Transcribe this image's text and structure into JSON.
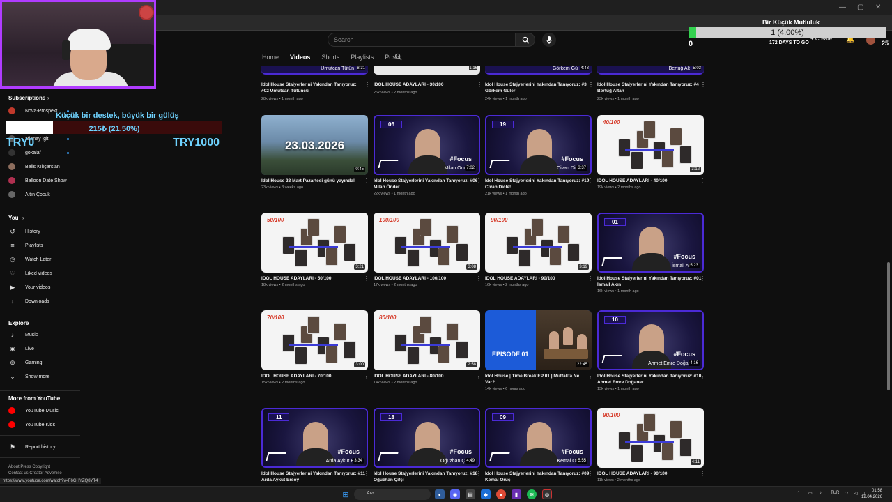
{
  "overlay": {
    "goal": {
      "title": "Bir Küçük Mutluluk",
      "progress_text": "1 (4.00%)",
      "progress_fraction": 0.04,
      "min": "0",
      "days_left": "172 DAYS TO GO",
      "max": "25"
    },
    "donation": {
      "title": "Küçük bir destek, büyük bir gülüş",
      "amount_text": "215₺ (21.50%)",
      "progress_fraction": 0.215,
      "min": "TRY0",
      "max": "TRY1000"
    }
  },
  "header": {
    "search_placeholder": "Search",
    "create_label": "Create"
  },
  "channel_tabs": [
    "Home",
    "Videos",
    "Shorts",
    "Playlists",
    "Posts"
  ],
  "sidebar": {
    "subscriptions_label": "Subscriptions",
    "subscriptions": [
      {
        "label": "Nova-Prospekt",
        "color": "#c0392b"
      },
      {
        "label": "Onur",
        "color": "#7f8c8d"
      },
      {
        "label": "aflanay igit",
        "color": "#555"
      },
      {
        "label": "gokalaf",
        "color": "#333"
      },
      {
        "label": "Belis Kılıçarslan",
        "color": "#8e6e5e"
      },
      {
        "label": "Balloon Date Show",
        "color": "#b03050"
      },
      {
        "label": "Altın Çocuk",
        "color": "#666"
      }
    ],
    "you_label": "You",
    "you_items": [
      {
        "label": "History",
        "icon": "history-icon",
        "glyph": "↺"
      },
      {
        "label": "Playlists",
        "icon": "playlists-icon",
        "glyph": "≡"
      },
      {
        "label": "Watch Later",
        "icon": "watch-later-icon",
        "glyph": "◷"
      },
      {
        "label": "Liked videos",
        "icon": "like-icon",
        "glyph": "♡"
      },
      {
        "label": "Your videos",
        "icon": "your-videos-icon",
        "glyph": "▶"
      },
      {
        "label": "Downloads",
        "icon": "download-icon",
        "glyph": "↓"
      }
    ],
    "explore_label": "Explore",
    "explore_items": [
      {
        "label": "Music",
        "icon": "music-icon",
        "glyph": "♪"
      },
      {
        "label": "Live",
        "icon": "live-icon",
        "glyph": "◉"
      },
      {
        "label": "Gaming",
        "icon": "gaming-icon",
        "glyph": "⊕"
      },
      {
        "label": "Show more",
        "icon": "chevron-down-icon",
        "glyph": "⌄"
      }
    ],
    "more_label": "More from YouTube",
    "more_items": [
      {
        "label": "YouTube Music",
        "color": "#ff0000"
      },
      {
        "label": "YouTube Kids",
        "color": "#ff0000"
      }
    ],
    "report_label": "Report history",
    "footer1": "About  Press  Copyright",
    "footer2": "Contact us  Creator  Advertise"
  },
  "top_row": [
    {
      "name": "Umutcan Tütün",
      "dur": "8:31",
      "title": "Idol House Stajyerlerini Yakından Tanıyoruz: #02 Umutcan Tütüncü",
      "meta": "28k views • 1 month ago"
    },
    {
      "name": "",
      "dur": "1:16",
      "title": "IDOL HOUSE ADAYLARI - 30/100",
      "meta": "26k views • 2 months ago"
    },
    {
      "name": "Görkem Gü",
      "dur": "4:43",
      "title": "Idol House Stajyerlerini Yakından Tanıyoruz: #3 Görkem Güler",
      "meta": "24k views • 1 month ago"
    },
    {
      "name": "Bertuğ Alt",
      "dur": "5:03",
      "title": "Idol House Stajyerlerini Yakından Tanıyoruz: #4 Bertuğ Altan",
      "meta": "23k views • 1 month ago"
    }
  ],
  "videos": [
    {
      "kind": "photo",
      "bg": "#5a7a9a",
      "big": "23.03.2026",
      "label": "",
      "name": "",
      "dur": "0:45",
      "title": "Idol House 23 Mart Pazartesi günü yayında!",
      "meta": "23k views • 3 weeks ago"
    },
    {
      "kind": "focus",
      "bg": "#1f1a4a",
      "label": "06",
      "name": "Milan Önc",
      "dur": "7:02",
      "title": "Idol House Stajyerlerini Yakından Tanıyoruz: #06 Milan Önder",
      "meta": "22k views • 1 month ago"
    },
    {
      "kind": "focus",
      "bg": "#1f1a4a",
      "label": "19",
      "name": "Civan Dic",
      "dur": "3:37",
      "title": "Idol House Stajyerlerini Yakından Tanıyoruz: #19 Civan Dicle!",
      "meta": "21k views • 1 month ago"
    },
    {
      "kind": "collage",
      "bg": "#f4f4f4",
      "label": "40/100",
      "name": "",
      "dur": "3:12",
      "title": "IDOL HOUSE ADAYLARI - 40/100",
      "meta": "19k views • 2 months ago"
    },
    {
      "kind": "collage",
      "bg": "#f4f4f4",
      "label": "50/100",
      "name": "",
      "dur": "3:21",
      "title": "IDOL HOUSE ADAYLARI - 50/100",
      "meta": "18k views • 2 months ago"
    },
    {
      "kind": "collage",
      "bg": "#f4f4f4",
      "label": "100/100",
      "name": "",
      "dur": "3:08",
      "title": "IDOL HOUSE ADAYLARI - 100/100",
      "meta": "17k views • 2 months ago"
    },
    {
      "kind": "collage",
      "bg": "#f4f4f4",
      "label": "90/100",
      "name": "",
      "dur": "3:19",
      "title": "IDOL HOUSE ADAYLARI - 90/100",
      "meta": "16k views • 2 months ago"
    },
    {
      "kind": "focus",
      "bg": "#1f1a4a",
      "label": "01",
      "name": "İsmail Al",
      "dur": "5:23",
      "title": "Idol House Stajyerlerini Yakından Tanıyoruz: #01 İsmail Akın",
      "meta": "16k views • 1 month ago"
    },
    {
      "kind": "collage",
      "bg": "#f4f4f4",
      "label": "70/100",
      "name": "",
      "dur": "3:00",
      "title": "IDOL HOUSE ADAYLARI - 70/100",
      "meta": "15k views • 2 months ago"
    },
    {
      "kind": "collage",
      "bg": "#f4f4f4",
      "label": "80/100",
      "name": "",
      "dur": "2:58",
      "title": "IDOL HOUSE ADAYLARI - 80/100",
      "meta": "14k views • 2 months ago"
    },
    {
      "kind": "episode",
      "bg": "#1c5bd8",
      "label": "EPISODE 01",
      "name": "",
      "dur": "22:45",
      "title": "Idol House | Time Break EP 01 | Mutfakta Ne Var?",
      "meta": "14k views • 6 hours ago"
    },
    {
      "kind": "focus",
      "bg": "#1f1a4a",
      "label": "10",
      "name": "Ahmet Emre Doğar",
      "dur": "4:16",
      "title": "Idol House Stajyerlerini Yakından Tanıyoruz: #10 Ahmet Emre Doğaner",
      "meta": "13k views • 1 month ago"
    },
    {
      "kind": "focus",
      "bg": "#1f1a4a",
      "label": "11",
      "name": "Arda Aykut E",
      "dur": "3:34",
      "title": "Idol House Stajyerlerini Yakından Tanıyoruz: #11 Arda Aykut Ersoy",
      "meta": ""
    },
    {
      "kind": "focus",
      "bg": "#1f1a4a",
      "label": "18",
      "name": "Oğuzhan Çi",
      "dur": "4:49",
      "title": "Idol House Stajyerlerini Yakından Tanıyoruz: #18 Oğuzhan Çifçi",
      "meta": ""
    },
    {
      "kind": "focus",
      "bg": "#1f1a4a",
      "label": "09",
      "name": "Kemal Or",
      "dur": "5:55",
      "title": "Idol House Stajyerlerini Yakından Tanıyoruz: #09 Kemal Oruç",
      "meta": ""
    },
    {
      "kind": "collage",
      "bg": "#f4f4f4",
      "label": "90/100",
      "name": "",
      "dur": "4:11",
      "title": "IDOL HOUSE ADAYLARI - 90/100",
      "meta": "11k views • 2 months ago"
    }
  ],
  "focus_tag": "#Focus",
  "status_url": "https://www.youtube.com/watch?v=F6GHYZQ8YT4",
  "taskbar": {
    "search_label": "Ara",
    "lang": "TUR",
    "time": "01:58",
    "date": "12.04.2026"
  },
  "colors": {
    "accent_blue": "#6fd3ff",
    "goal_green": "#33d14f",
    "focus_purple": "#4b2ad6",
    "cam_border": "#b03cff"
  }
}
